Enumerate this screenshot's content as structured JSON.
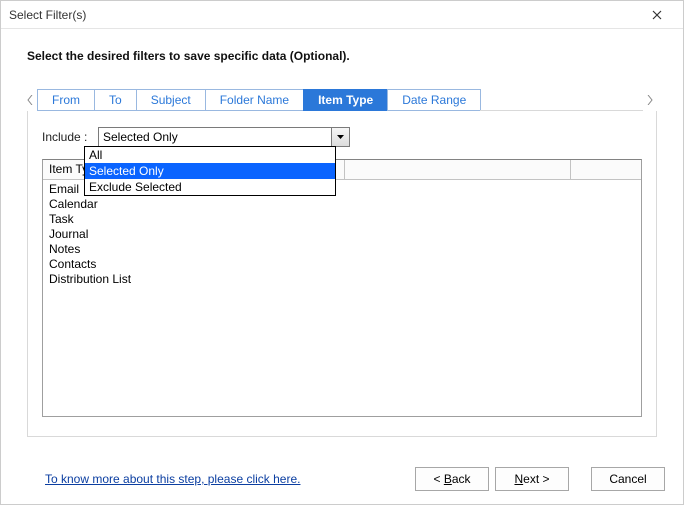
{
  "window": {
    "title": "Select Filter(s)"
  },
  "instruction": "Select the desired filters to save specific data (Optional).",
  "tabs": {
    "items": [
      {
        "label": "From"
      },
      {
        "label": "To"
      },
      {
        "label": "Subject"
      },
      {
        "label": "Folder Name"
      },
      {
        "label": "Item Type"
      },
      {
        "label": "Date Range"
      }
    ],
    "active_index": 4
  },
  "include": {
    "label": "Include :",
    "value": "Selected Only",
    "options": [
      "All",
      "Selected Only",
      "Exclude Selected"
    ],
    "highlighted_index": 1
  },
  "list": {
    "header": "Item Type",
    "items": [
      "Email",
      "Calendar",
      "Task",
      "Journal",
      "Notes",
      "Contacts",
      "Distribution List"
    ]
  },
  "help_link": "To know more about this step, please click here.",
  "buttons": {
    "back_sym": "<",
    "back_u": "B",
    "back_rest": "ack",
    "next_u": "N",
    "next_rest": "ext",
    "next_sym": ">",
    "cancel": "Cancel"
  }
}
